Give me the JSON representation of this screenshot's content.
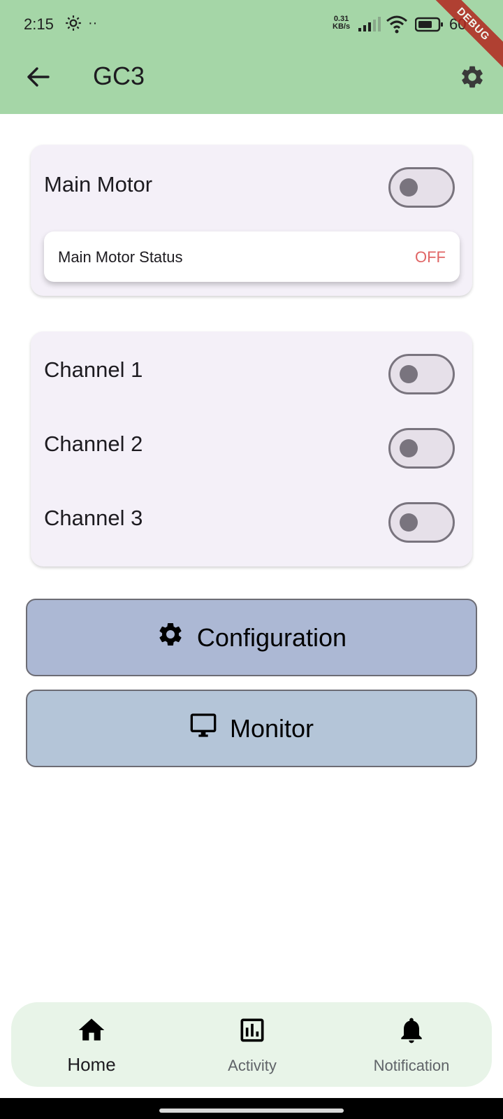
{
  "status_bar": {
    "time": "2:15",
    "dots": "··",
    "net_speed_value": "0.31",
    "net_speed_unit": "KB/s",
    "battery_text": "60"
  },
  "debug_banner": "DEBUG",
  "app_bar": {
    "title": "GC3",
    "back_icon": "arrow-left-icon",
    "settings_icon": "gear-icon"
  },
  "motor_card": {
    "label": "Main Motor",
    "switch_on": false,
    "status_label": "Main Motor Status",
    "status_value": "OFF",
    "status_color": "#e06666"
  },
  "channels": [
    {
      "label": "Channel 1",
      "switch_on": false
    },
    {
      "label": "Channel 2",
      "switch_on": false
    },
    {
      "label": "Channel 3",
      "switch_on": false
    }
  ],
  "buttons": {
    "configuration": {
      "label": "Configuration",
      "icon": "gear-icon",
      "color": "#acb8d4"
    },
    "monitor": {
      "label": "Monitor",
      "icon": "monitor-icon",
      "color": "#b4c5d8"
    }
  },
  "bottom_nav": {
    "items": [
      {
        "label": "Home",
        "icon": "home-icon",
        "active": true
      },
      {
        "label": "Activity",
        "icon": "bar-chart-icon",
        "active": false
      },
      {
        "label": "Notification",
        "icon": "bell-icon",
        "active": false
      }
    ]
  },
  "colors": {
    "app_bar": "#a5d6a7",
    "card": "#f4f0f8",
    "nav_bar": "#e8f4e8"
  }
}
